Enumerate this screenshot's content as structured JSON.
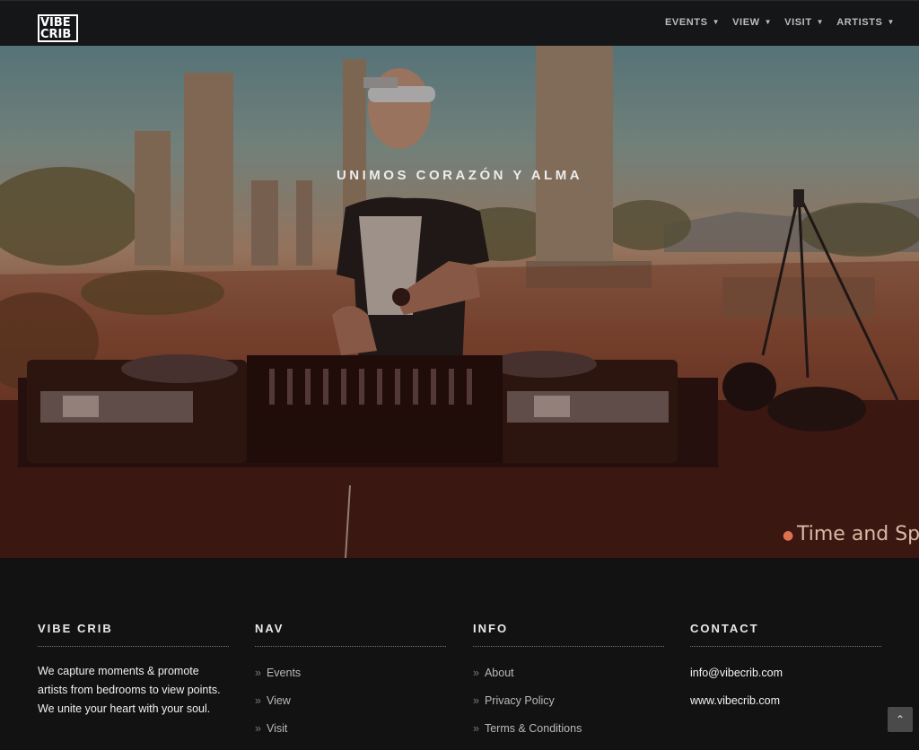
{
  "header": {
    "logo_line1": "VIBE",
    "logo_line2": "CRIB",
    "nav": [
      {
        "label": "EVENTS"
      },
      {
        "label": "VIEW"
      },
      {
        "label": "VISIT"
      },
      {
        "label": "ARTISTS"
      }
    ]
  },
  "hero": {
    "tagline": "UNIMOS CORAZÓN Y ALMA",
    "location_text": "Time and Spa",
    "icon": "map-pin-icon"
  },
  "footer": {
    "about": {
      "title": "VIBE CRIB",
      "text_lines": [
        "We capture moments & promote",
        "artists from bedrooms to view points.",
        "We unite your heart with your soul."
      ]
    },
    "nav": {
      "title": "NAV",
      "links": [
        "Events",
        "View",
        "Visit"
      ]
    },
    "info": {
      "title": "INFO",
      "links": [
        "About",
        "Privacy Policy",
        "Terms & Conditions"
      ]
    },
    "contact": {
      "title": "CONTACT",
      "email": "info@vibecrib.com",
      "website": "www.vibecrib.com"
    }
  },
  "scroll_top_icon": "chevron-double-up-icon"
}
